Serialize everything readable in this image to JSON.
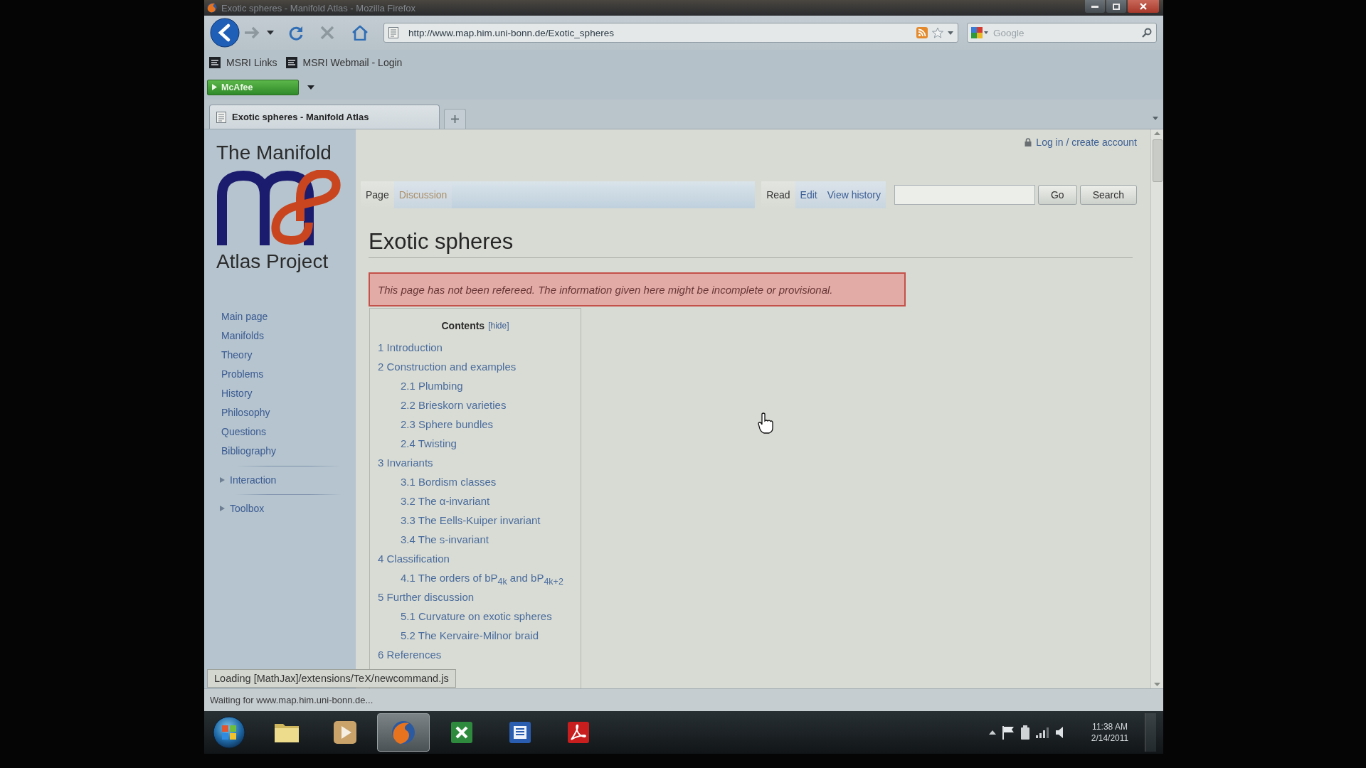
{
  "window": {
    "title": "Exotic spheres - Manifold Atlas - Mozilla Firefox"
  },
  "toolbar": {
    "nav_buttons": [
      {
        "kind": "back",
        "disabled": false
      },
      {
        "kind": "forward",
        "disabled": true
      },
      {
        "kind": "history",
        "disabled": false
      },
      {
        "kind": "reload",
        "disabled": false
      },
      {
        "kind": "stop",
        "disabled": true
      },
      {
        "kind": "home",
        "disabled": false
      }
    ],
    "url": "http://www.map.him.uni-bonn.de/Exotic_spheres",
    "search": {
      "placeholder": "Google"
    }
  },
  "bookmarks": [
    {
      "label": "MSRI Links"
    },
    {
      "label": "MSRI Webmail - Login"
    }
  ],
  "addon_bar": {
    "label": "McAfee"
  },
  "browser_tabs": [
    {
      "label": "Exotic spheres - Manifold Atlas",
      "selected": true
    }
  ],
  "page": {
    "logo": {
      "line_1": "The Manifold",
      "line_2": "Atlas Project"
    },
    "sidebar": {
      "links": [
        "Main page",
        "Manifolds",
        "Theory",
        "Problems",
        "History",
        "Philosophy",
        "Questions",
        "Bibliography"
      ],
      "sections": [
        {
          "label": "Interaction",
          "expanded": false
        },
        {
          "label": "Toolbox",
          "expanded": false
        }
      ]
    },
    "user_link": "Log in / create account",
    "namespace_tabs": [
      {
        "label": "Page",
        "selected": true,
        "new": false
      },
      {
        "label": "Discussion",
        "selected": false,
        "new": true
      }
    ],
    "view_tabs": [
      {
        "label": "Read",
        "selected": true
      },
      {
        "label": "Edit",
        "selected": false
      },
      {
        "label": "View history",
        "selected": false
      }
    ],
    "search_buttons": [
      "Go",
      "Search"
    ],
    "title": "Exotic spheres",
    "notice": "This page has not been refereed. The information given here might be incomplete or provisional.",
    "toc": {
      "title": "Contents",
      "toggle": "[hide]",
      "items": [
        {
          "number": "1",
          "text": "Introduction"
        },
        {
          "number": "2",
          "text": "Construction and examples",
          "children": [
            {
              "number": "2.1",
              "text": "Plumbing"
            },
            {
              "number": "2.2",
              "text": "Brieskorn varieties"
            },
            {
              "number": "2.3",
              "text": "Sphere bundles"
            },
            {
              "number": "2.4",
              "text": "Twisting"
            }
          ]
        },
        {
          "number": "3",
          "text": "Invariants",
          "children": [
            {
              "number": "3.1",
              "text": "Bordism classes"
            },
            {
              "number": "3.2",
              "text": "The α-invariant"
            },
            {
              "number": "3.3",
              "text": "The Eells-Kuiper invariant"
            },
            {
              "number": "3.4",
              "text": "The s-invariant"
            }
          ]
        },
        {
          "number": "4",
          "text": "Classification",
          "children": [
            {
              "number": "4.1",
              "text": "The orders of bP$_{4k}$ and bP$_{4k+2}$"
            }
          ]
        },
        {
          "number": "5",
          "text": "Further discussion",
          "children": [
            {
              "number": "5.1",
              "text": "Curvature on exotic spheres"
            },
            {
              "number": "5.2",
              "text": "The Kervaire-Milnor braid"
            }
          ]
        },
        {
          "number": "6",
          "text": "References"
        }
      ]
    }
  },
  "loading_message": "Loading [MathJax]/extensions/TeX/newcommand.js",
  "status_bar": "Waiting for www.map.him.uni-bonn.de...",
  "taskbar": {
    "apps": [
      {
        "kind": "folder",
        "selected": false
      },
      {
        "kind": "media",
        "selected": false
      },
      {
        "kind": "browser",
        "selected": true
      },
      {
        "kind": "spreadsheet",
        "selected": false
      },
      {
        "kind": "document",
        "selected": false
      },
      {
        "kind": "pdf",
        "selected": false
      }
    ],
    "time": "11:38 AM",
    "date": "2/14/2011"
  }
}
